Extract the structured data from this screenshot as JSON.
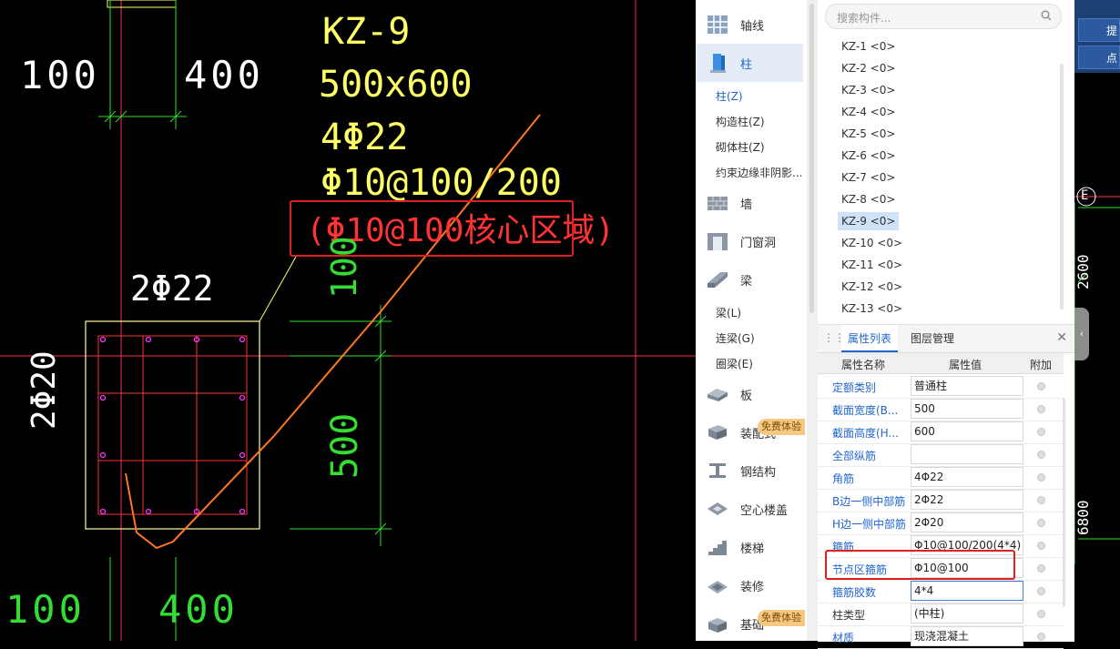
{
  "drawing": {
    "dim_top_left": "100",
    "dim_top_right": "400",
    "col_label": "KZ-9",
    "col_size": "500x600",
    "corner_bars": "4Φ22",
    "stirrups": "Φ10@100/200",
    "core_note": "(Φ10@100核心区域)",
    "b_side_bars": "2Φ22",
    "h_side_bars": "2Φ20",
    "dim_vert_upper": "100",
    "dim_vert_mid": "500",
    "dim_bot_left": "100",
    "dim_bot_right": "400",
    "grid_axis_label": "E",
    "right_dim_1": "2600",
    "right_dim_2": "6800",
    "colors": {
      "yellow": "#ffff66",
      "white": "#ffffff",
      "green": "#33dd33",
      "red": "#ff3333",
      "orange": "#ff7722",
      "magenta": "#ff33ff"
    }
  },
  "categories": {
    "axis": {
      "label": "轴线",
      "icon": "grid-icon"
    },
    "column": {
      "label": "柱",
      "icon": "column-icon"
    },
    "column_sub": [
      "柱(Z)",
      "构造柱(Z)",
      "砌体柱(Z)",
      "约束边缘非阴影..."
    ],
    "wall": {
      "label": "墙",
      "icon": "wall-icon"
    },
    "opening": {
      "label": "门窗洞",
      "icon": "door-window-icon"
    },
    "beam": {
      "label": "梁",
      "icon": "beam-icon"
    },
    "beam_sub": [
      "梁(L)",
      "连梁(G)",
      "圈梁(E)"
    ],
    "slab": {
      "label": "板",
      "icon": "slab-icon"
    },
    "assembly": {
      "label": "装配式",
      "icon": "prefab-icon"
    },
    "steel": {
      "label": "钢结构",
      "icon": "steel-icon"
    },
    "hollow": {
      "label": "空心楼盖",
      "icon": "hollow-slab-icon"
    },
    "stair": {
      "label": "楼梯",
      "icon": "stair-icon"
    },
    "decor": {
      "label": "装修",
      "icon": "decoration-icon"
    },
    "foundation": {
      "label": "基础",
      "icon": "foundation-icon"
    },
    "trial_badge": "免费体验"
  },
  "component_list": {
    "search_placeholder": "搜索构件...",
    "items": [
      "KZ-1 <0>",
      "KZ-2 <0>",
      "KZ-3 <0>",
      "KZ-4 <0>",
      "KZ-5 <0>",
      "KZ-6 <0>",
      "KZ-7 <0>",
      "KZ-8 <0>",
      "KZ-9 <0>",
      "KZ-10 <0>",
      "KZ-11 <0>",
      "KZ-12 <0>",
      "KZ-13 <0>"
    ],
    "selected": "KZ-9 <0>"
  },
  "properties": {
    "tabs": [
      "属性列表",
      "图层管理"
    ],
    "headers": [
      "属性名称",
      "属性值",
      "附加"
    ],
    "rows": [
      {
        "name": "定额类别",
        "value": "普通柱"
      },
      {
        "name": "截面宽度(B...",
        "value": "500"
      },
      {
        "name": "截面高度(H...",
        "value": "600"
      },
      {
        "name": "全部纵筋",
        "value": ""
      },
      {
        "name": "角筋",
        "value": "4Φ22"
      },
      {
        "name": "B边一侧中部筋",
        "value": "2Φ22"
      },
      {
        "name": "H边一侧中部筋",
        "value": "2Φ20"
      },
      {
        "name": "箍筋",
        "value": "Φ10@100/200(4*4)"
      },
      {
        "name": "节点区箍筋",
        "value": "Φ10@100"
      },
      {
        "name": "箍筋胶数",
        "value": "4*4"
      },
      {
        "name": "柱类型",
        "value": "(中柱)"
      },
      {
        "name": "材质",
        "value": "现浇混凝土"
      }
    ]
  },
  "toolbar": {
    "btn1": "提",
    "btn2": "点"
  }
}
